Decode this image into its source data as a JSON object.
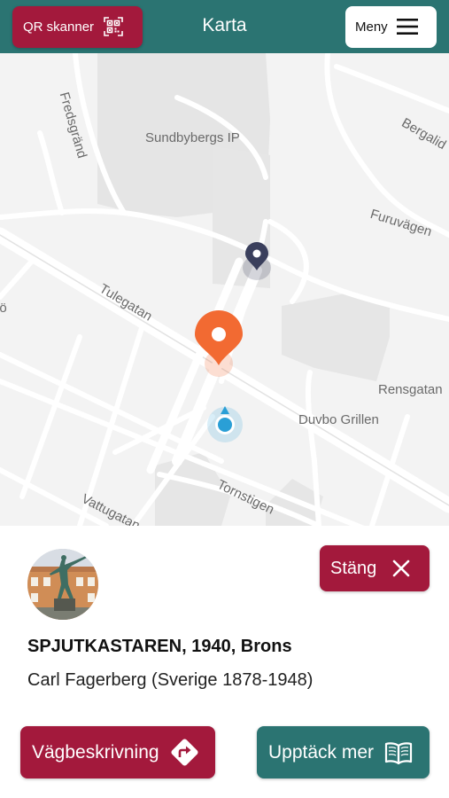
{
  "header": {
    "qr_label": "QR skanner",
    "title": "Karta",
    "menu_label": "Meny"
  },
  "map": {
    "labels": {
      "fredsgrand": "Fredsgränd",
      "sundbybergs_ip": "Sundbybergs IP",
      "bergal": "Bergalid",
      "furuvagen": "Furuvägen",
      "tulegatan": "Tulegatan",
      "jo": "jö",
      "rensgatan": "Rensgatan",
      "duvbo_grillen": "Duvbo Grillen",
      "tornstigen": "Tornstigen",
      "vattugatan": "Vattugatan"
    },
    "colors": {
      "selected_pin": "#f26a32",
      "other_pin": "#3a3f5c",
      "user_location": "#2a9fd6"
    }
  },
  "panel": {
    "close_label": "Stäng",
    "artwork_title": "SPJUTKASTAREN, 1940, Brons",
    "artist": "Carl Fagerberg (Sverige 1878-1948)",
    "directions_label": "Vägbeskrivning",
    "discover_label": "Upptäck mer"
  },
  "colors": {
    "primary_red": "#a3193c",
    "primary_teal": "#2b7472"
  },
  "icons": [
    "qr-code-icon",
    "menu-icon",
    "location-pin-icon",
    "user-location-icon",
    "close-icon",
    "directions-icon",
    "book-icon"
  ]
}
